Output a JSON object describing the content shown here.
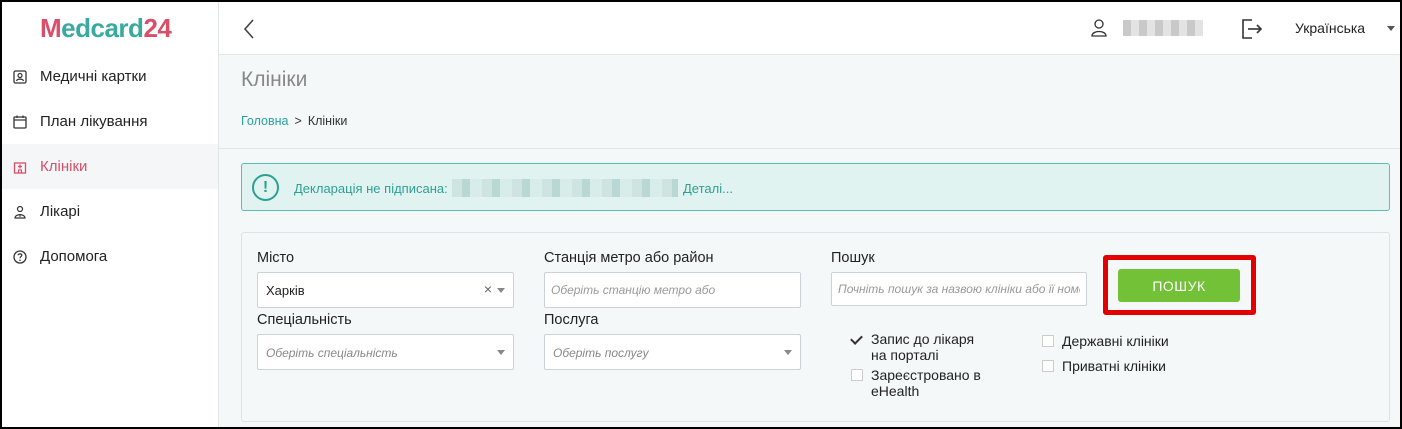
{
  "logo": {
    "m": "M",
    "rest": "edcard",
    "num": "24"
  },
  "sidebar": {
    "items": [
      {
        "label": "Медичні картки",
        "icon": "id-card-icon"
      },
      {
        "label": "План лікування",
        "icon": "calendar-icon"
      },
      {
        "label": "Клініки",
        "icon": "hospital-icon",
        "active": true
      },
      {
        "label": "Лікарі",
        "icon": "doctor-icon"
      },
      {
        "label": "Допомога",
        "icon": "help-icon"
      }
    ]
  },
  "header": {
    "language": "Українська"
  },
  "page": {
    "title": "Клініки",
    "breadcrumb": {
      "home": "Головна",
      "separator": ">",
      "current": "Клініки"
    }
  },
  "alert": {
    "text": "Декларація не підписана:",
    "link": "Деталі..."
  },
  "filters": {
    "city": {
      "label": "Місто",
      "value": "Харків",
      "clear": "×"
    },
    "metro": {
      "label": "Станція метро або район",
      "placeholder": "Оберіть станцію метро або"
    },
    "search": {
      "label": "Пошук",
      "placeholder": "Почніть пошук за назвою клініки або її номеру"
    },
    "search_button": "ПОШУК",
    "specialty": {
      "label": "Спеціальність",
      "placeholder": "Оберіть спеціальність"
    },
    "service": {
      "label": "Послуга",
      "placeholder": "Оберіть послугу"
    },
    "checkboxes": {
      "appointment": {
        "line1": "Запис до лікаря",
        "line2": "на порталі",
        "checked": true
      },
      "ehealth": {
        "line1": "Зареєстровано в",
        "line2": "eHealth",
        "checked": false
      },
      "state": {
        "label": "Державні клініки",
        "checked": false
      },
      "private": {
        "label": "Приватні клініки",
        "checked": false
      }
    }
  },
  "colors": {
    "brand_pink": "#d94f6a",
    "brand_teal": "#3aa9a0",
    "alert_teal": "#2e9f93",
    "search_green": "#72c137",
    "highlight_red": "#e30000"
  }
}
